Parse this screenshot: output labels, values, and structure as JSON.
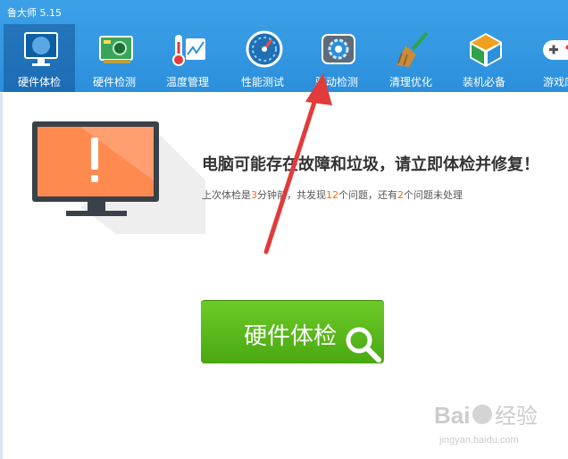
{
  "app": {
    "title": "鲁大师 5.15"
  },
  "tabs": [
    {
      "label": "硬件体检",
      "icon": "monitor-check-icon",
      "active": true
    },
    {
      "label": "硬件检测",
      "icon": "circuit-board-icon"
    },
    {
      "label": "温度管理",
      "icon": "thermometer-icon"
    },
    {
      "label": "性能测试",
      "icon": "speedometer-icon"
    },
    {
      "label": "驱动检测",
      "icon": "gear-chip-icon"
    },
    {
      "label": "清理优化",
      "icon": "broom-icon"
    },
    {
      "label": "装机必备",
      "icon": "cube-icon"
    },
    {
      "label": "游戏库",
      "icon": "gamepad-icon"
    }
  ],
  "main": {
    "headline": "电脑可能存在故障和垃圾，请立即体检并修复！",
    "status": {
      "prefix": "上次体检是",
      "minutes": "3",
      "mid1": "分钟前，共发现",
      "issues": "12",
      "mid2": "个问题，还有",
      "pending": "2",
      "suffix": "个问题未处理"
    },
    "button_label": "硬件体检"
  },
  "watermark": {
    "brand": "Baidu经验",
    "url": "jingyan.baidu.com"
  },
  "colors": {
    "accent": "#2b8fdc",
    "button": "#56b71a",
    "number": "#ff6a00",
    "arrow": "#e23b3b"
  }
}
